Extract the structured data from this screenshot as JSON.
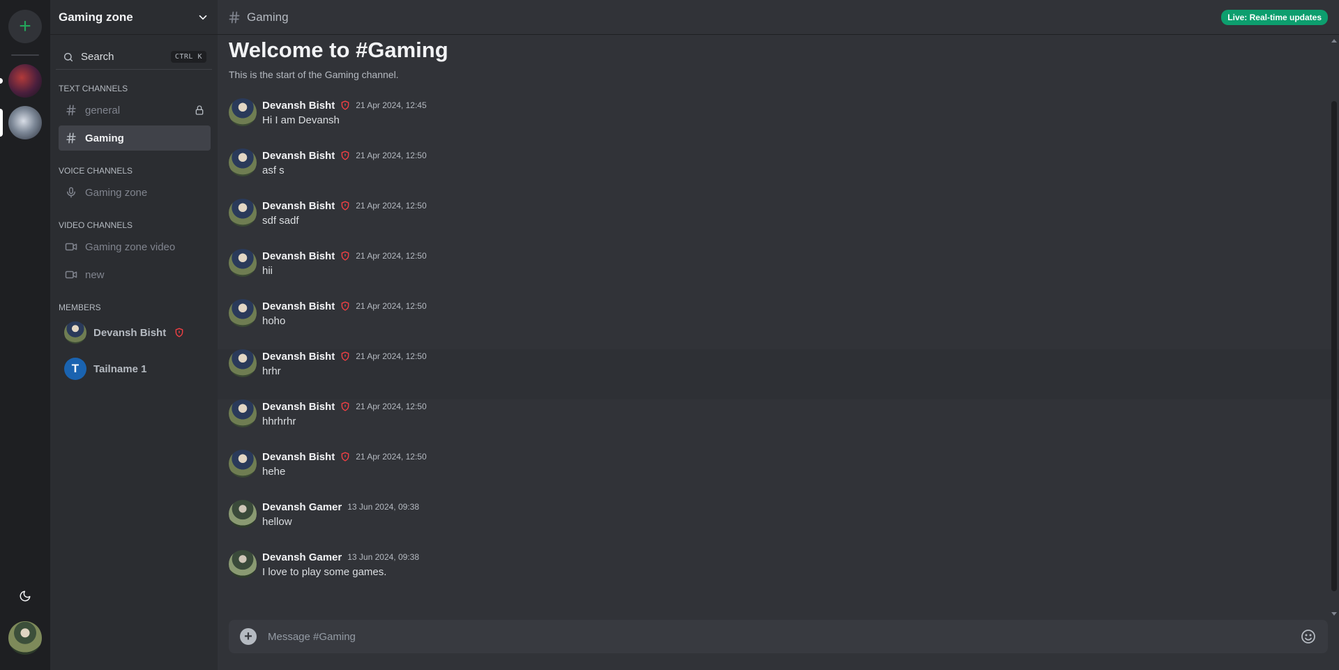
{
  "rail": {
    "add_symbol": "+",
    "servers": [
      {
        "name": "server-1",
        "active": false
      },
      {
        "name": "server-2",
        "active": true
      }
    ]
  },
  "sidebar": {
    "server_name": "Gaming zone",
    "search": {
      "label": "Search",
      "shortcut": "CTRL K"
    },
    "sections": {
      "text": "TEXT CHANNELS",
      "voice": "VOICE CHANNELS",
      "video": "VIDEO CHANNELS",
      "members": "MEMBERS"
    },
    "text_channels": [
      {
        "name": "general",
        "locked": true,
        "active": false
      },
      {
        "name": "Gaming",
        "locked": false,
        "active": true
      }
    ],
    "voice_channels": [
      {
        "name": "Gaming zone"
      }
    ],
    "video_channels": [
      {
        "name": "Gaming zone video"
      },
      {
        "name": "new"
      }
    ],
    "members": [
      {
        "name": "Devansh Bisht",
        "role": "admin",
        "avatar": "photo"
      },
      {
        "name": "Tailname 1",
        "role": "",
        "avatar": "letter",
        "initial": "T"
      }
    ]
  },
  "header": {
    "channel": "Gaming",
    "live_badge": "Live: Real-time updates"
  },
  "welcome": {
    "title": "Welcome to #Gaming",
    "subtitle": "This is the start of the Gaming channel."
  },
  "messages": [
    {
      "author": "Devansh Bisht",
      "admin": true,
      "time": "21 Apr 2024, 12:45",
      "text": "Hi I am Devansh"
    },
    {
      "author": "Devansh Bisht",
      "admin": true,
      "time": "21 Apr 2024, 12:50",
      "text": "asf s"
    },
    {
      "author": "Devansh Bisht",
      "admin": true,
      "time": "21 Apr 2024, 12:50",
      "text": "sdf sadf"
    },
    {
      "author": "Devansh Bisht",
      "admin": true,
      "time": "21 Apr 2024, 12:50",
      "text": "hii"
    },
    {
      "author": "Devansh Bisht",
      "admin": true,
      "time": "21 Apr 2024, 12:50",
      "text": "hoho"
    },
    {
      "author": "Devansh Bisht",
      "admin": true,
      "time": "21 Apr 2024, 12:50",
      "text": "hrhr",
      "hover": true
    },
    {
      "author": "Devansh Bisht",
      "admin": true,
      "time": "21 Apr 2024, 12:50",
      "text": "hhrhrhr"
    },
    {
      "author": "Devansh Bisht",
      "admin": true,
      "time": "21 Apr 2024, 12:50",
      "text": "hehe"
    },
    {
      "author": "Devansh Gamer",
      "admin": false,
      "time": "13 Jun 2024, 09:38",
      "text": "hellow"
    },
    {
      "author": "Devansh Gamer",
      "admin": false,
      "time": "13 Jun 2024, 09:38",
      "text": "I love to play some games."
    }
  ],
  "composer": {
    "placeholder": "Message #Gaming",
    "plus_symbol": "+"
  },
  "colors": {
    "accent_green": "#23a55a",
    "live_badge": "#0d9e6e",
    "admin_shield": "#f23f43"
  },
  "icons": {
    "add_server": "plus-icon",
    "theme_toggle": "moon-icon",
    "server_menu": "chevron-down-icon",
    "search": "search-icon",
    "text_channel": "hash-icon",
    "locked": "lock-icon",
    "voice_channel": "microphone-icon",
    "video_channel": "video-icon",
    "admin_role": "shield-icon",
    "composer_add": "plus-circle-icon",
    "emoji": "smiley-icon"
  }
}
